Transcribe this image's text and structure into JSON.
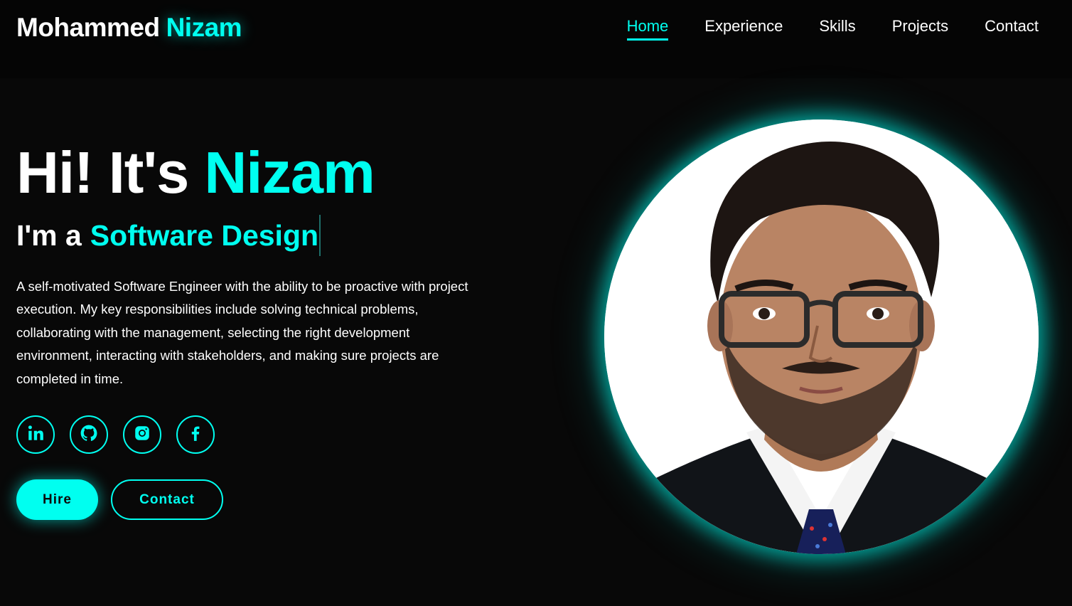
{
  "header": {
    "logo_first": "Mohammed",
    "logo_last": "Nizam",
    "nav": [
      {
        "label": "Home",
        "active": true
      },
      {
        "label": "Experience",
        "active": false
      },
      {
        "label": "Skills",
        "active": false
      },
      {
        "label": "Projects",
        "active": false
      },
      {
        "label": "Contact",
        "active": false
      }
    ]
  },
  "hero": {
    "greeting": "Hi! It's",
    "name": "Nizam",
    "role_prefix": "I'm a",
    "role": "Software Design",
    "description": "A self-motivated Software Engineer with the ability to be proactive with project execution. My key responsibilities include solving technical problems, collaborating with the management, selecting the right development environment, interacting with stakeholders, and making sure projects are completed in time."
  },
  "socials": [
    {
      "icon": "linkedin-icon"
    },
    {
      "icon": "github-icon"
    },
    {
      "icon": "instagram-icon"
    },
    {
      "icon": "facebook-icon"
    }
  ],
  "buttons": {
    "hire": "Hire",
    "contact": "Contact"
  },
  "colors": {
    "accent": "#00fff0",
    "background": "#080808",
    "text": "#ffffff"
  }
}
